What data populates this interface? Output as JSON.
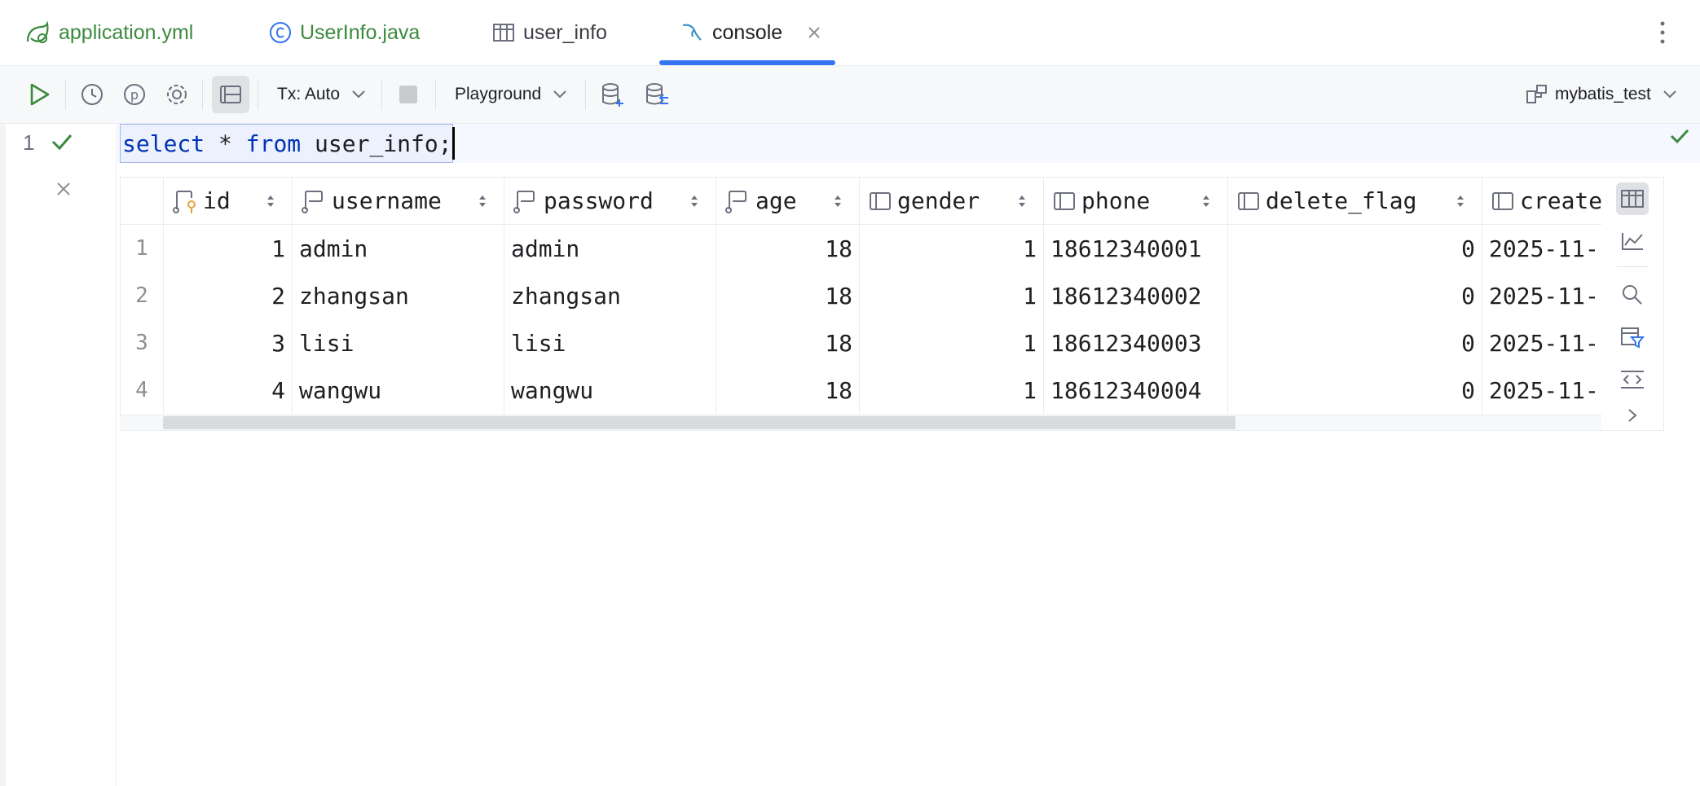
{
  "tabs": [
    {
      "label": "application.yml",
      "icon": "spring-config-icon"
    },
    {
      "label": "UserInfo.java",
      "icon": "java-class-icon"
    },
    {
      "label": "user_info",
      "icon": "table-icon"
    },
    {
      "label": "console",
      "icon": "mysql-dolphin-icon",
      "active": true
    }
  ],
  "toolbar": {
    "tx_label": "Tx: Auto",
    "mode_label": "Playground",
    "datasource_label": "mybatis_test"
  },
  "editor": {
    "line_number": "1",
    "query": {
      "kw1": "select",
      "mid1": " * ",
      "kw2": "from",
      "rest": " user_info;"
    }
  },
  "grid": {
    "columns": [
      "id",
      "username",
      "password",
      "age",
      "gender",
      "phone",
      "delete_flag",
      "create"
    ],
    "rows": [
      {
        "n": "1",
        "id": "1",
        "username": "admin",
        "password": "admin",
        "age": "18",
        "gender": "1",
        "phone": "18612340001",
        "delete_flag": "0",
        "create": "2025-11-"
      },
      {
        "n": "2",
        "id": "2",
        "username": "zhangsan",
        "password": "zhangsan",
        "age": "18",
        "gender": "1",
        "phone": "18612340002",
        "delete_flag": "0",
        "create": "2025-11-"
      },
      {
        "n": "3",
        "id": "3",
        "username": "lisi",
        "password": "lisi",
        "age": "18",
        "gender": "1",
        "phone": "18612340003",
        "delete_flag": "0",
        "create": "2025-11-"
      },
      {
        "n": "4",
        "id": "4",
        "username": "wangwu",
        "password": "wangwu",
        "age": "18",
        "gender": "1",
        "phone": "18612340004",
        "delete_flag": "0",
        "create": "2025-11-"
      }
    ]
  },
  "colors": {
    "accent": "#3574f0",
    "green": "#3b8a3e",
    "keyword": "#0033b3"
  }
}
